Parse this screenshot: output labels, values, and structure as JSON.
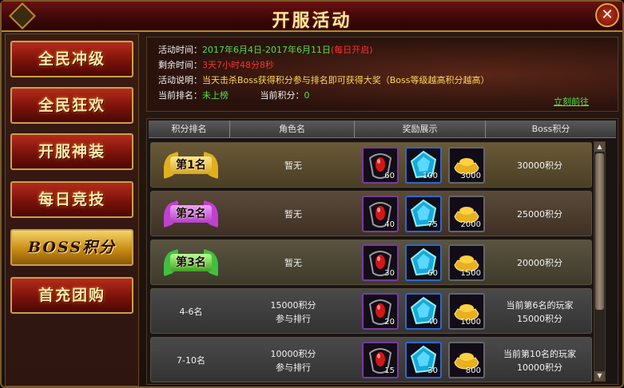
{
  "window": {
    "title": "开服活动",
    "close_label": "✕"
  },
  "sidebar": {
    "items": [
      {
        "label": "全民冲级",
        "active": false
      },
      {
        "label": "全民狂欢",
        "active": false
      },
      {
        "label": "开服神装",
        "active": false
      },
      {
        "label": "每日竞技",
        "active": false
      },
      {
        "label": "BOSS积分",
        "active": true
      },
      {
        "label": "首充团购",
        "active": false
      }
    ]
  },
  "info": {
    "time_label": "活动时间：",
    "time_value": "2017年6月4日-2017年6月11日",
    "time_note": "(每日开启)",
    "remain_label": "剩余时间：",
    "remain_value": "3天7小时48分8秒",
    "desc_label": "活动说明：",
    "desc_value": "当天击杀Boss获得积分参与排名即可获得大奖（Boss等级越高积分越高）",
    "rank_label": "当前排名：",
    "rank_value": "未上榜",
    "score_label": "当前积分：",
    "score_value": "0",
    "goto_label": "立刻前往"
  },
  "table": {
    "headers": [
      "积分排名",
      "角色名",
      "奖励展示",
      "Boss积分"
    ],
    "rows": [
      {
        "rank": "第1名",
        "badge": "gold",
        "name": "暂无",
        "items": [
          "60",
          "100",
          "3000"
        ],
        "score": "30000积分"
      },
      {
        "rank": "第2名",
        "badge": "purple",
        "name": "暂无",
        "items": [
          "40",
          "75",
          "2000"
        ],
        "score": "25000积分"
      },
      {
        "rank": "第3名",
        "badge": "green",
        "name": "暂无",
        "items": [
          "30",
          "60",
          "1500"
        ],
        "score": "20000积分"
      },
      {
        "rank": "4-6名",
        "badge": "",
        "name": "15000积分\n参与排行",
        "items": [
          "20",
          "40",
          "1000"
        ],
        "score": "当前第6名的玩家\n15000积分"
      },
      {
        "rank": "7-10名",
        "badge": "",
        "name": "10000积分\n参与排行",
        "items": [
          "15",
          "30",
          "800"
        ],
        "score": "当前第10名的玩家\n10000积分"
      }
    ]
  },
  "colors": {
    "accent_gold": "#c9a04b",
    "text_green": "#52e04a",
    "text_red": "#ff3030"
  },
  "icons": {
    "item1": "red-gem-amulet-icon",
    "item2": "blue-crystal-icon",
    "item3": "gold-ingot-icon"
  }
}
